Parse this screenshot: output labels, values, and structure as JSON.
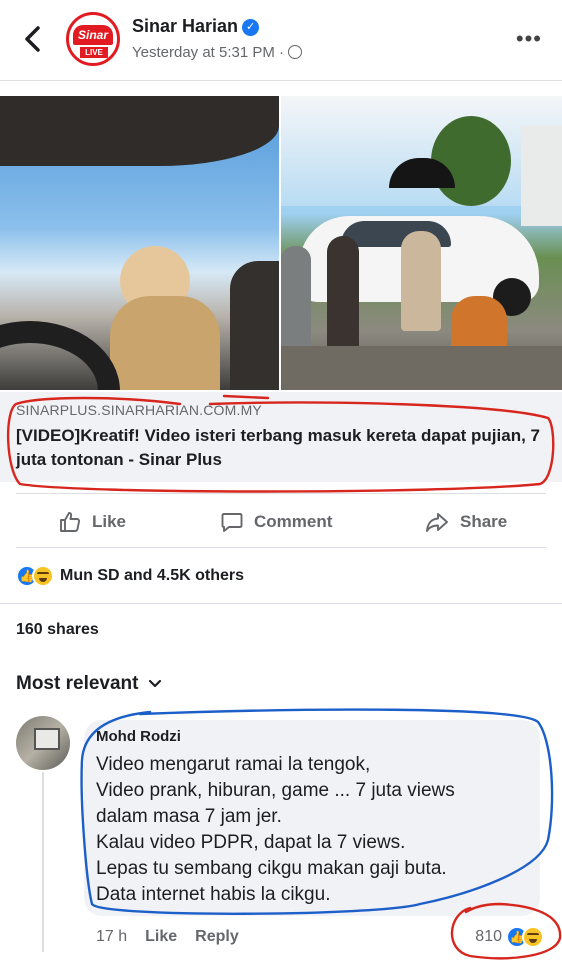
{
  "post": {
    "page_name": "Sinar Harian",
    "logo_text": "Sinar",
    "logo_live": "LIVE",
    "timestamp": "Yesterday at 5:31 PM ·",
    "more_label": "•••"
  },
  "link": {
    "domain": "SINARPLUS.SINARHARIAN.COM.MY",
    "title": "[VIDEO]Kreatif! Video isteri terbang masuk kereta dapat pujian, 7 juta tontonan - Sinar Plus"
  },
  "actions": {
    "like": "Like",
    "comment": "Comment",
    "share": "Share"
  },
  "reactions": {
    "summary": "Mun SD and 4.5K others"
  },
  "shares": "160 shares",
  "sort": {
    "label": "Most relevant"
  },
  "comment": {
    "author": "Mohd Rodzi",
    "lines": [
      "Video mengarut ramai la tengok,",
      "Video prank, hiburan, game ... 7 juta views",
      "dalam masa 7 jam jer.",
      "Kalau video PDPR, dapat la 7 views.",
      "Lepas tu sembang cikgu makan gaji buta.",
      "Data internet habis la cikgu."
    ],
    "time": "17 h",
    "like_label": "Like",
    "reply_label": "Reply",
    "reaction_count": "810"
  },
  "colors": {
    "brand_blue": "#1877f2",
    "annotation_red": "#d7261e",
    "annotation_blue": "#1d5fc9",
    "sinar_red": "#e21b23"
  }
}
